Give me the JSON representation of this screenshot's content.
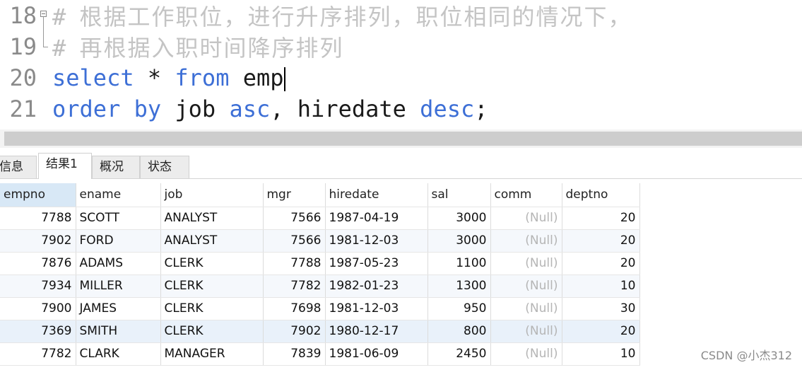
{
  "editor": {
    "lines": [
      {
        "num": "18",
        "prefix": "# ",
        "text": "根据工作职位，进行升序排列，职位相同的情况下，"
      },
      {
        "num": "19",
        "prefix": "# ",
        "text": "再根据入职时间降序排列"
      },
      {
        "num": "20",
        "kw1": "select",
        "mid": " * ",
        "kw2": "from",
        "tail": " emp"
      },
      {
        "num": "21",
        "kw1": "order by",
        "mid": " job ",
        "kw2": "asc",
        "mid2": ", hiredate ",
        "kw3": "desc",
        "tail": ";"
      }
    ]
  },
  "tabs": [
    {
      "label": "信息",
      "active": false
    },
    {
      "label": "结果1",
      "active": true
    },
    {
      "label": "概况",
      "active": false
    },
    {
      "label": "状态",
      "active": false
    }
  ],
  "grid": {
    "columns": [
      "empno",
      "ename",
      "job",
      "mgr",
      "hiredate",
      "sal",
      "comm",
      "deptno"
    ],
    "rows": [
      [
        "7788",
        "SCOTT",
        "ANALYST",
        "7566",
        "1987-04-19",
        "3000",
        "(Null)",
        "20"
      ],
      [
        "7902",
        "FORD",
        "ANALYST",
        "7566",
        "1981-12-03",
        "3000",
        "(Null)",
        "20"
      ],
      [
        "7876",
        "ADAMS",
        "CLERK",
        "7788",
        "1987-05-23",
        "1100",
        "(Null)",
        "20"
      ],
      [
        "7934",
        "MILLER",
        "CLERK",
        "7782",
        "1982-01-23",
        "1300",
        "(Null)",
        "10"
      ],
      [
        "7900",
        "JAMES",
        "CLERK",
        "7698",
        "1981-12-03",
        "950",
        "(Null)",
        "30"
      ],
      [
        "7369",
        "SMITH",
        "CLERK",
        "7902",
        "1980-12-17",
        "800",
        "(Null)",
        "20"
      ],
      [
        "7782",
        "CLARK",
        "MANAGER",
        "7839",
        "1981-06-09",
        "2450",
        "(Null)",
        "10"
      ]
    ]
  },
  "watermark": "CSDN @小杰312"
}
